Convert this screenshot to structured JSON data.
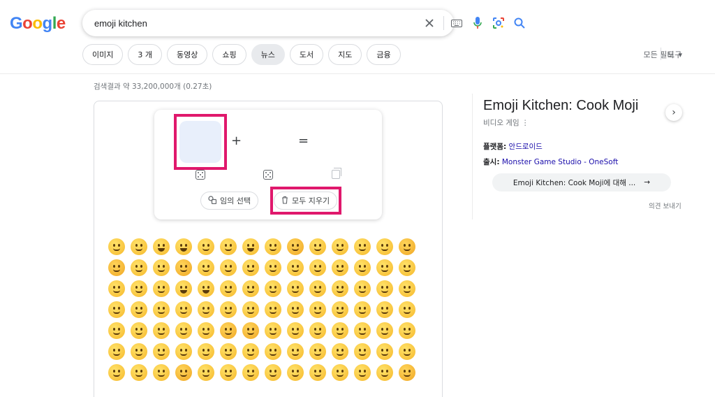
{
  "logo": {
    "letters": [
      "G",
      "o",
      "o",
      "g",
      "l",
      "e"
    ]
  },
  "search": {
    "query": "emoji kitchen"
  },
  "chips": [
    "이미지",
    "3 개",
    "동영상",
    "쇼핑",
    "뉴스",
    "도서",
    "지도",
    "금융"
  ],
  "tools": {
    "all_filters": "모든 필터",
    "tools": "도구"
  },
  "result_stats": "검색결과 약 33,200,000개 (0.27초)",
  "mixer": {
    "plus": "+",
    "equals": "=",
    "random_label": "임의 선택",
    "clear_label": "모두 지우기"
  },
  "knowledge_panel": {
    "title": "Emoji Kitchen: Cook Moji",
    "subtitle": "비디오 게임",
    "platform_label": "플랫폼:",
    "platform_value": "안드로이드",
    "release_label": "출시:",
    "release_value": "Monster Game Studio - OneSoft",
    "about_button": "Emoji Kitchen: Cook Moji에 대해 ...",
    "feedback": "의견 보내기"
  },
  "colors": {
    "highlight": "#e0186c",
    "link": "#1a0dab"
  }
}
